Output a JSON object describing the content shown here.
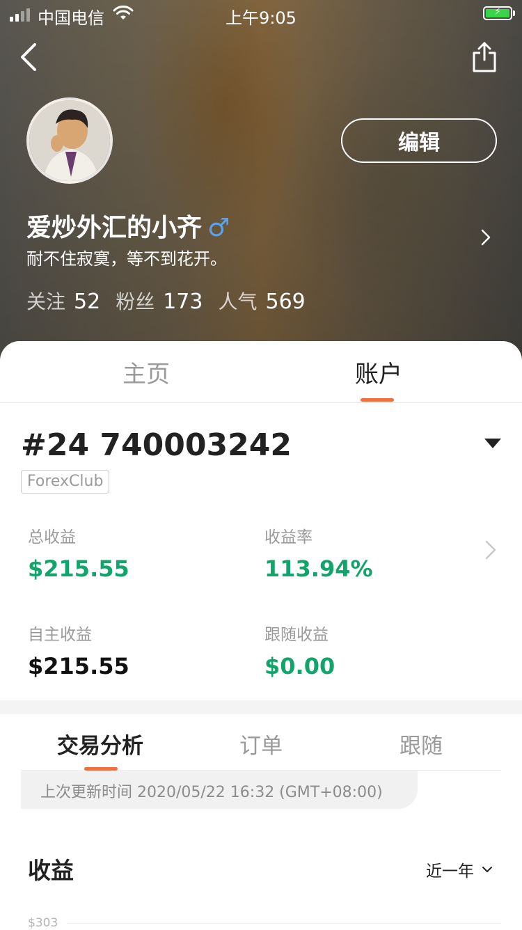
{
  "status_bar": {
    "carrier": "中国电信",
    "time": "上午9:05"
  },
  "header": {
    "edit_label": "编辑",
    "username": "爱炒外汇的小齐",
    "gender_symbol": "♂",
    "bio": "耐不住寂寞，等不到花开。",
    "stats": [
      {
        "label": "关注",
        "value": "52"
      },
      {
        "label": "粉丝",
        "value": "173"
      },
      {
        "label": "人气",
        "value": "569"
      }
    ]
  },
  "main_tabs": [
    {
      "label": "主页",
      "active": false
    },
    {
      "label": "账户",
      "active": true
    }
  ],
  "account": {
    "id": "#24 740003242",
    "broker": "ForexClub"
  },
  "metrics": {
    "total_profit": {
      "label": "总收益",
      "value": "$215.55"
    },
    "return_rate": {
      "label": "收益率",
      "value": "113.94%"
    },
    "own_profit": {
      "label": "自主收益",
      "value": "$215.55"
    },
    "follow_profit": {
      "label": "跟随收益",
      "value": "$0.00"
    }
  },
  "sub_tabs": [
    {
      "label": "交易分析",
      "active": true
    },
    {
      "label": "订单",
      "active": false
    },
    {
      "label": "跟随",
      "active": false
    }
  ],
  "last_update": "上次更新时间 2020/05/22 16:32 (GMT+08:00)",
  "profit_section": {
    "title": "收益",
    "period": "近一年",
    "y_tick": "$303"
  },
  "colors": {
    "accent": "#f0703f",
    "positive": "#12a46a",
    "gender": "#5aa4ee"
  }
}
